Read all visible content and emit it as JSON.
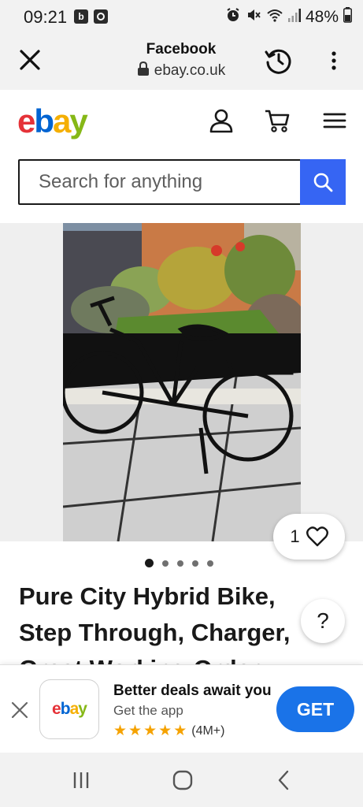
{
  "status": {
    "time": "09:21",
    "notif1": "b",
    "battery": "48%"
  },
  "browser": {
    "title": "Facebook",
    "domain": "ebay.co.uk"
  },
  "ebay": {
    "logo": [
      "e",
      "b",
      "a",
      "y"
    ],
    "logo_colors": [
      "#e53238",
      "#0064d2",
      "#f5af02",
      "#86b817"
    ]
  },
  "search": {
    "placeholder": "Search for anything"
  },
  "gallery": {
    "watch_count": "1",
    "dots_total": 5,
    "active_dot": 0
  },
  "item": {
    "title_line1": "Pure City Hybrid Bike,",
    "title_line2": "Step Through, Charger,",
    "title_line3": "Great Working Order",
    "help_label": "?"
  },
  "app_banner": {
    "headline": "Better deals await you",
    "sub": "Get the app",
    "rating_count": "(4M+)",
    "get_label": "GET",
    "stars": 5
  }
}
